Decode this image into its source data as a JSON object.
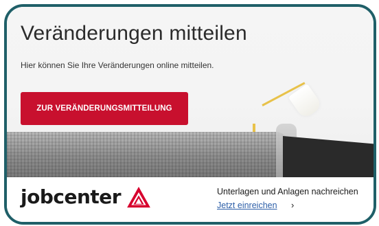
{
  "hero": {
    "title": "Veränderungen mitteilen",
    "description": "Hier können Sie Ihre Veränderungen online mitteilen.",
    "cta_label": "ZUR VERÄNDERUNGSMITTEILUNG"
  },
  "footer": {
    "brand": "jobcenter",
    "heading": "Unterlagen und Anlagen nachreichen",
    "link_label": "Jetzt einreichen",
    "link_icon": "chevron-right-icon"
  },
  "colors": {
    "accent": "#c8102e",
    "frame_border": "#1f5f68",
    "link": "#2d5fa8"
  }
}
